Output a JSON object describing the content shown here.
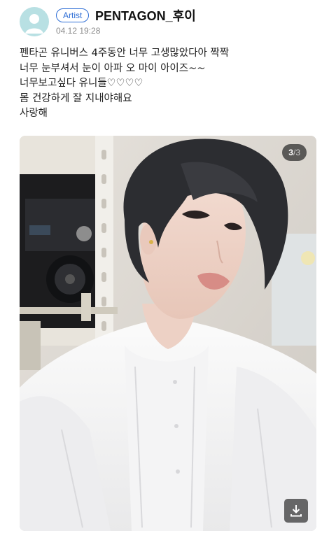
{
  "post": {
    "author": {
      "badge": "Artist",
      "name": "PENTAGON_후이",
      "avatar_icon": "default-avatar-icon",
      "avatar_color": "#b8e0e3"
    },
    "timestamp": "04.12 19:28",
    "body_lines": [
      "펜타곤 유니버스 4주동안 너무 고생많았다아 짝짝",
      "너무 눈부셔서 눈이 아파 오 마이 아이즈~~",
      "너무보고싶다 유니들♡♡♡♡",
      "몸 건강하게 잘 지내야해요",
      "사랑해"
    ],
    "media": {
      "current": "3",
      "separator": "/",
      "total": "3",
      "download_icon": "download-icon"
    }
  },
  "colors": {
    "badge_blue": "#2f6fd6",
    "timestamp_gray": "#8a8a8a",
    "counter_bg": "#2a2a2a"
  }
}
